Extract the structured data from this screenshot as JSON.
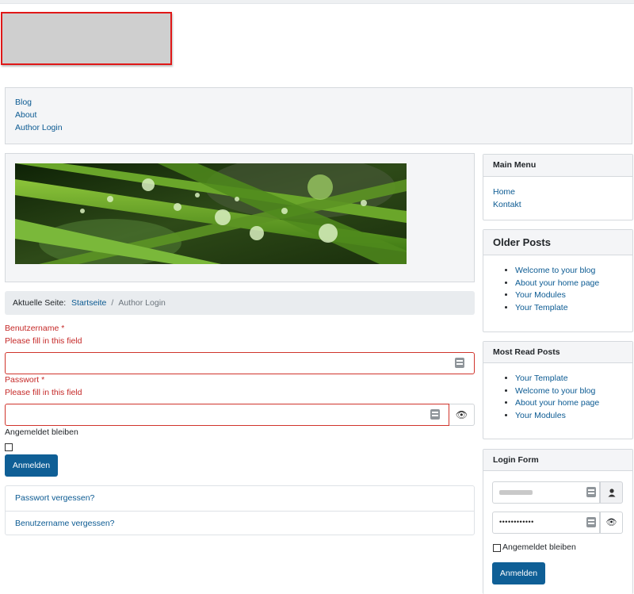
{
  "nav": {
    "items": [
      "Blog",
      "About",
      "Author Login"
    ]
  },
  "breadcrumb": {
    "prefix": "Aktuelle Seite:",
    "home": "Startseite",
    "separator": "/",
    "current": "Author Login"
  },
  "login": {
    "username_label": "Benutzername *",
    "username_error": "Please fill in this field",
    "password_label": "Passwort *",
    "password_error": "Please fill in this field",
    "remember_label": "Angemeldet bleiben",
    "submit_label": "Anmelden",
    "forgot_password": "Passwort vergessen?",
    "forgot_username": "Benutzername vergessen?"
  },
  "sidebar": {
    "main_menu": {
      "title": "Main Menu",
      "items": [
        "Home",
        "Kontakt"
      ]
    },
    "older_posts": {
      "title": "Older Posts",
      "items": [
        "Welcome to your blog",
        "About your home page",
        "Your Modules",
        "Your Template"
      ]
    },
    "most_read": {
      "title": "Most Read Posts",
      "items": [
        "Your Template",
        "Welcome to your blog",
        "About your home page",
        "Your Modules"
      ]
    },
    "login_form": {
      "title": "Login Form",
      "password_mask": "••••••••••••",
      "remember_label": "Angemeldet bleiben",
      "submit_label": "Anmelden"
    }
  },
  "colors": {
    "accent": "#0f5f96",
    "error": "#c52827",
    "link": "#0b5a92"
  }
}
